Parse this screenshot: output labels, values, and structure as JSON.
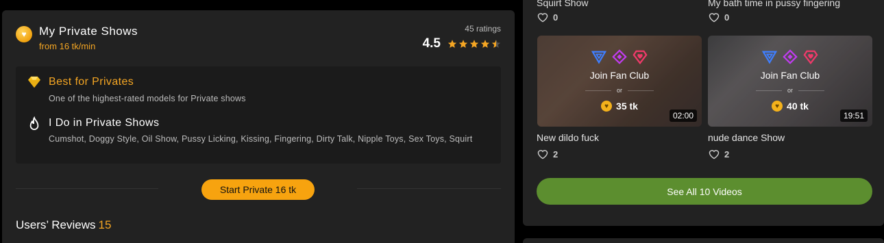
{
  "private_shows": {
    "title": "My Private Shows",
    "price_from": "from 16 tk/min",
    "ratings_count": "45 ratings",
    "rating_value": "4.5",
    "stars": 4.5,
    "best": {
      "title": "Best for Privates",
      "description": "One of the highest-rated models for Private shows"
    },
    "do_in": {
      "title": "I Do in Private Shows",
      "description": "Cumshot, Doggy Style, Oil Show, Pussy Licking, Kissing, Fingering, Dirty Talk, Nipple Toys, Sex Toys, Squirt"
    },
    "start_button": "Start Private 16 tk"
  },
  "reviews": {
    "title": "Users’ Reviews",
    "count": "15"
  },
  "videos": {
    "top": [
      {
        "title": "Squirt Show",
        "likes": "0"
      },
      {
        "title": "My bath time in pussy fingering",
        "likes": "0"
      }
    ],
    "cards": [
      {
        "join": "Join Fan Club",
        "or": "or",
        "price": "35 tk",
        "duration": "02:00",
        "title": "New dildo fuck",
        "likes": "2"
      },
      {
        "join": "Join Fan Club",
        "or": "or",
        "price": "40 tk",
        "duration": "19:51",
        "title": "nude dance Show",
        "likes": "2"
      }
    ],
    "see_all": "See All 10 Videos"
  },
  "colors": {
    "accent": "#f5a623",
    "see_all_green": "#5c8e2f",
    "panel": "#222222",
    "fan_blue": "#3f7fff",
    "fan_purple": "#c03cf0",
    "fan_pink": "#f03a6a"
  },
  "icons": [
    "heart-coin-icon",
    "diamond-icon",
    "flame-icon",
    "star-icon",
    "heart-outline-icon",
    "fan-club-blue-icon",
    "fan-club-purple-icon",
    "fan-club-pink-icon",
    "token-coin-icon"
  ]
}
